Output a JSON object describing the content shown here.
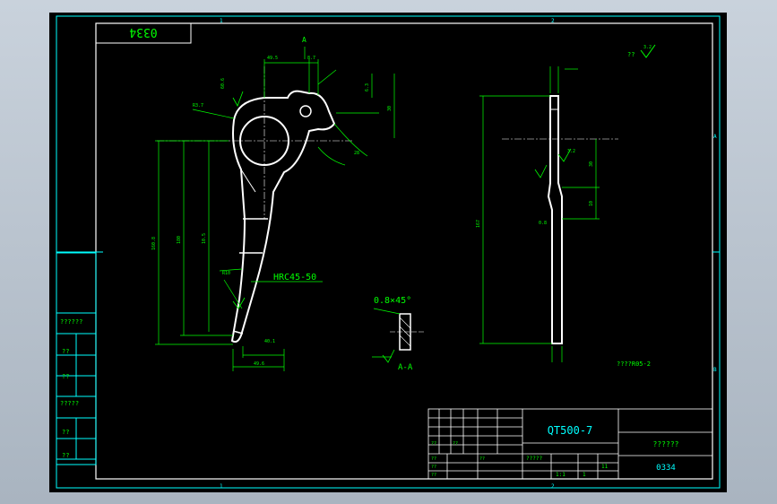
{
  "colors": {
    "background": "#000000",
    "frame": "#00ffff",
    "geometry": "#ffffff",
    "dimension": "#00ff00",
    "text_dim": "#00ff00",
    "window_bg": "#b0bac6"
  },
  "title_stamp": "0334",
  "material": "QT500-7",
  "drawing_number": "0334",
  "part_name": "??????",
  "roughness_note": "??",
  "roughness_value": "3.2",
  "hardness": "HRC45-50",
  "chamfer": "0.8×45°",
  "section_label": "A-A",
  "view_label": "A",
  "tech_note": "????R05-2",
  "zone_markers": {
    "top_left": "1",
    "top_right": "2",
    "bottom_left": "1",
    "bottom_right": "2",
    "left": "A",
    "right": "A",
    "right_bottom": "B"
  },
  "left_block": [
    "??????",
    "??",
    "??",
    "?????",
    "??",
    "??"
  ],
  "title_block": {
    "row_labels": [
      "??",
      "??",
      "??",
      "??",
      "??",
      "??"
    ],
    "scale": "1:1",
    "sheet": "1",
    "mark": "?????",
    "count": "11"
  },
  "dims_main": {
    "d1": "60.6",
    "d2": "49.5",
    "d3": "30",
    "d4": "R3.7",
    "d5": "8.7",
    "d6": "160.8",
    "d7": "180",
    "d8": "R10",
    "d9": "40.1",
    "d10": "49.6",
    "d11": "10.5",
    "d12": "6.3",
    "d13": "28"
  },
  "dims_side": {
    "s1": "167",
    "s2": "30",
    "s3": "10",
    "s4": "0.8",
    "s5": "3.2"
  }
}
